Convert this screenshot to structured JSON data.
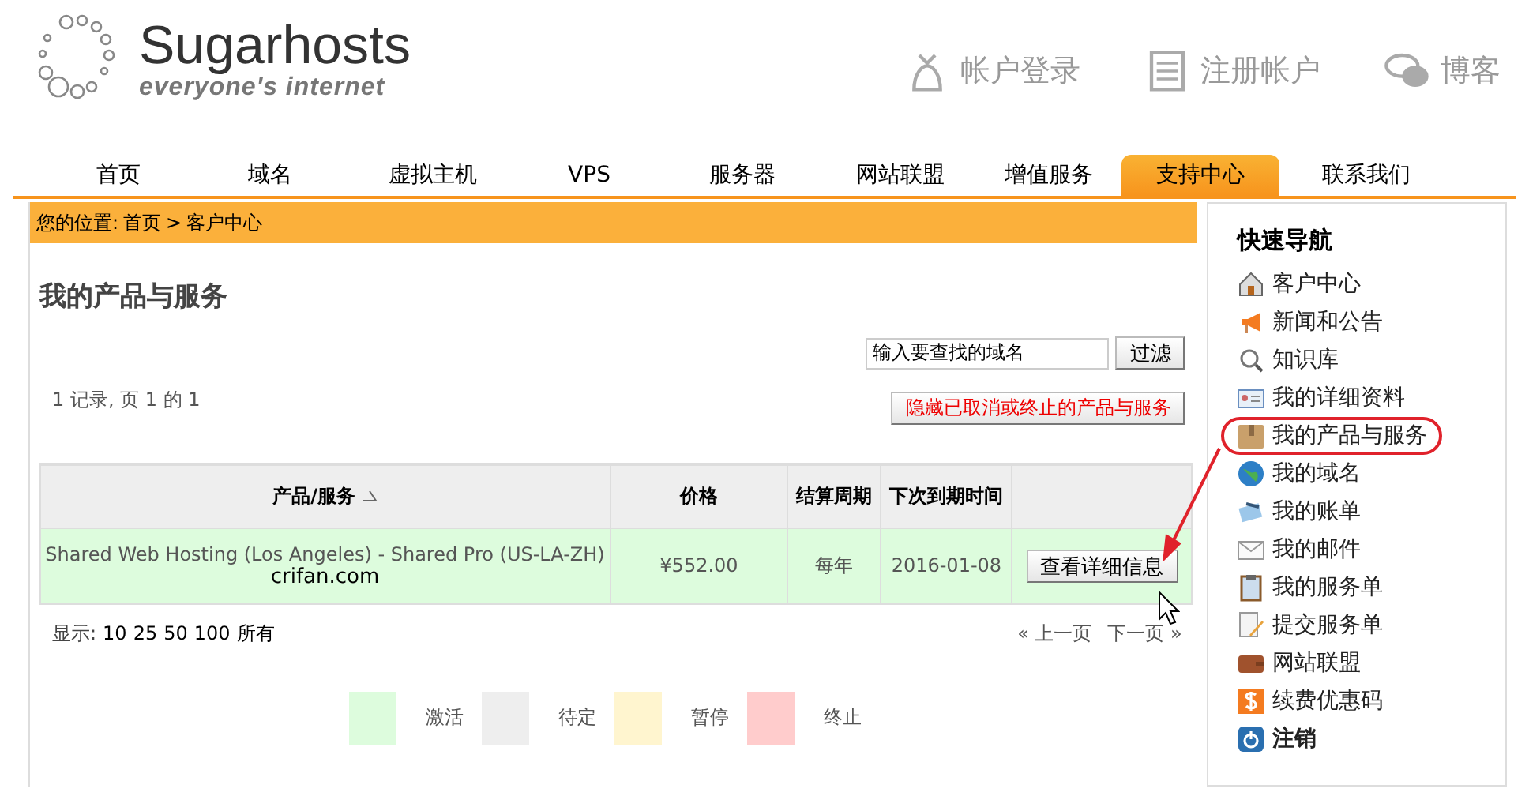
{
  "logo": {
    "name": "Sugarhosts",
    "tagline": "everyone's internet"
  },
  "header_links": [
    {
      "label": "帐户登录"
    },
    {
      "label": "注册帐户"
    },
    {
      "label": "博客"
    }
  ],
  "nav_tabs": [
    {
      "label": "首页",
      "selected": false
    },
    {
      "label": "域名",
      "selected": false
    },
    {
      "label": "虚拟主机",
      "selected": false
    },
    {
      "label": "VPS",
      "selected": false
    },
    {
      "label": "服务器",
      "selected": false
    },
    {
      "label": "网站联盟",
      "selected": false
    },
    {
      "label": "增值服务",
      "selected": false
    },
    {
      "label": "支持中心",
      "selected": true
    },
    {
      "label": "联系我们",
      "selected": false
    }
  ],
  "breadcrumb": {
    "prefix": "您的位置:",
    "links": [
      "首页",
      "客户中心"
    ],
    "separator": ">"
  },
  "page_title": "我的产品与服务",
  "record_info": "1 记录, 页 1 的 1",
  "filter": {
    "value": "输入要查找的域名",
    "button": "过滤"
  },
  "hide_button": "隐藏已取消或终止的产品与服务",
  "table": {
    "columns": [
      "产品/服务",
      "价格",
      "结算周期",
      "下次到期时间"
    ],
    "rows": [
      {
        "product": "Shared Web Hosting (Los Angeles) - Shared Pro (US-LA-ZH)",
        "domain": "crifan.com",
        "price": "¥552.00",
        "cycle": "每年",
        "due": "2016-01-08",
        "action": "查看详细信息",
        "color": "#ddfcdd"
      }
    ]
  },
  "page_size": {
    "label": "显示:",
    "options": [
      "10",
      "25",
      "50",
      "100",
      "所有"
    ]
  },
  "pager": {
    "prev": "« 上一页",
    "next": "下一页 »"
  },
  "legend": [
    {
      "label": "激活",
      "color": "#ddfcdd"
    },
    {
      "label": "待定",
      "color": "#eeeeee"
    },
    {
      "label": "暂停",
      "color": "#fff5cf"
    },
    {
      "label": "终止",
      "color": "#ffcccc"
    }
  ],
  "sidebar": {
    "title": "快速导航",
    "items": [
      {
        "label": "客户中心",
        "circled": false,
        "kind": "link"
      },
      {
        "label": "新闻和公告",
        "circled": false,
        "kind": "link"
      },
      {
        "label": "知识库",
        "circled": false,
        "kind": "link"
      },
      {
        "label": "我的详细资料",
        "circled": false,
        "kind": "link"
      },
      {
        "label": "我的产品与服务",
        "circled": true,
        "kind": "link"
      },
      {
        "label": "我的域名",
        "circled": false,
        "kind": "link"
      },
      {
        "label": "我的账单",
        "circled": false,
        "kind": "link"
      },
      {
        "label": "我的邮件",
        "circled": false,
        "kind": "link"
      },
      {
        "label": "我的服务单",
        "circled": false,
        "kind": "link"
      },
      {
        "label": "提交服务单",
        "circled": false,
        "kind": "link"
      },
      {
        "label": "网站联盟",
        "circled": false,
        "kind": "link"
      },
      {
        "label": "续费优惠码",
        "circled": false,
        "kind": "link"
      },
      {
        "label": "注销",
        "circled": false,
        "kind": "logout"
      }
    ]
  }
}
